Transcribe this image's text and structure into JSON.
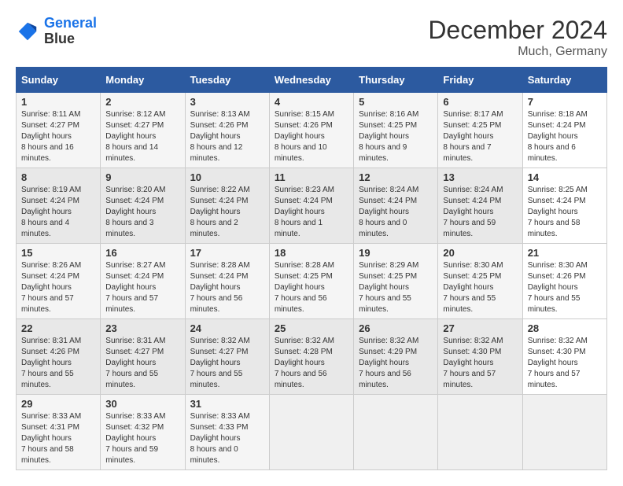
{
  "header": {
    "logo_line1": "General",
    "logo_line2": "Blue",
    "title": "December 2024",
    "subtitle": "Much, Germany"
  },
  "days_of_week": [
    "Sunday",
    "Monday",
    "Tuesday",
    "Wednesday",
    "Thursday",
    "Friday",
    "Saturday"
  ],
  "weeks": [
    [
      {
        "day": "1",
        "sunrise": "8:11 AM",
        "sunset": "4:27 PM",
        "daylight": "8 hours and 16 minutes."
      },
      {
        "day": "2",
        "sunrise": "8:12 AM",
        "sunset": "4:27 PM",
        "daylight": "8 hours and 14 minutes."
      },
      {
        "day": "3",
        "sunrise": "8:13 AM",
        "sunset": "4:26 PM",
        "daylight": "8 hours and 12 minutes."
      },
      {
        "day": "4",
        "sunrise": "8:15 AM",
        "sunset": "4:26 PM",
        "daylight": "8 hours and 10 minutes."
      },
      {
        "day": "5",
        "sunrise": "8:16 AM",
        "sunset": "4:25 PM",
        "daylight": "8 hours and 9 minutes."
      },
      {
        "day": "6",
        "sunrise": "8:17 AM",
        "sunset": "4:25 PM",
        "daylight": "8 hours and 7 minutes."
      },
      {
        "day": "7",
        "sunrise": "8:18 AM",
        "sunset": "4:24 PM",
        "daylight": "8 hours and 6 minutes."
      }
    ],
    [
      {
        "day": "8",
        "sunrise": "8:19 AM",
        "sunset": "4:24 PM",
        "daylight": "8 hours and 4 minutes."
      },
      {
        "day": "9",
        "sunrise": "8:20 AM",
        "sunset": "4:24 PM",
        "daylight": "8 hours and 3 minutes."
      },
      {
        "day": "10",
        "sunrise": "8:22 AM",
        "sunset": "4:24 PM",
        "daylight": "8 hours and 2 minutes."
      },
      {
        "day": "11",
        "sunrise": "8:23 AM",
        "sunset": "4:24 PM",
        "daylight": "8 hours and 1 minute."
      },
      {
        "day": "12",
        "sunrise": "8:24 AM",
        "sunset": "4:24 PM",
        "daylight": "8 hours and 0 minutes."
      },
      {
        "day": "13",
        "sunrise": "8:24 AM",
        "sunset": "4:24 PM",
        "daylight": "7 hours and 59 minutes."
      },
      {
        "day": "14",
        "sunrise": "8:25 AM",
        "sunset": "4:24 PM",
        "daylight": "7 hours and 58 minutes."
      }
    ],
    [
      {
        "day": "15",
        "sunrise": "8:26 AM",
        "sunset": "4:24 PM",
        "daylight": "7 hours and 57 minutes."
      },
      {
        "day": "16",
        "sunrise": "8:27 AM",
        "sunset": "4:24 PM",
        "daylight": "7 hours and 57 minutes."
      },
      {
        "day": "17",
        "sunrise": "8:28 AM",
        "sunset": "4:24 PM",
        "daylight": "7 hours and 56 minutes."
      },
      {
        "day": "18",
        "sunrise": "8:28 AM",
        "sunset": "4:25 PM",
        "daylight": "7 hours and 56 minutes."
      },
      {
        "day": "19",
        "sunrise": "8:29 AM",
        "sunset": "4:25 PM",
        "daylight": "7 hours and 55 minutes."
      },
      {
        "day": "20",
        "sunrise": "8:30 AM",
        "sunset": "4:25 PM",
        "daylight": "7 hours and 55 minutes."
      },
      {
        "day": "21",
        "sunrise": "8:30 AM",
        "sunset": "4:26 PM",
        "daylight": "7 hours and 55 minutes."
      }
    ],
    [
      {
        "day": "22",
        "sunrise": "8:31 AM",
        "sunset": "4:26 PM",
        "daylight": "7 hours and 55 minutes."
      },
      {
        "day": "23",
        "sunrise": "8:31 AM",
        "sunset": "4:27 PM",
        "daylight": "7 hours and 55 minutes."
      },
      {
        "day": "24",
        "sunrise": "8:32 AM",
        "sunset": "4:27 PM",
        "daylight": "7 hours and 55 minutes."
      },
      {
        "day": "25",
        "sunrise": "8:32 AM",
        "sunset": "4:28 PM",
        "daylight": "7 hours and 56 minutes."
      },
      {
        "day": "26",
        "sunrise": "8:32 AM",
        "sunset": "4:29 PM",
        "daylight": "7 hours and 56 minutes."
      },
      {
        "day": "27",
        "sunrise": "8:32 AM",
        "sunset": "4:30 PM",
        "daylight": "7 hours and 57 minutes."
      },
      {
        "day": "28",
        "sunrise": "8:32 AM",
        "sunset": "4:30 PM",
        "daylight": "7 hours and 57 minutes."
      }
    ],
    [
      {
        "day": "29",
        "sunrise": "8:33 AM",
        "sunset": "4:31 PM",
        "daylight": "7 hours and 58 minutes."
      },
      {
        "day": "30",
        "sunrise": "8:33 AM",
        "sunset": "4:32 PM",
        "daylight": "7 hours and 59 minutes."
      },
      {
        "day": "31",
        "sunrise": "8:33 AM",
        "sunset": "4:33 PM",
        "daylight": "8 hours and 0 minutes."
      },
      null,
      null,
      null,
      null
    ]
  ]
}
